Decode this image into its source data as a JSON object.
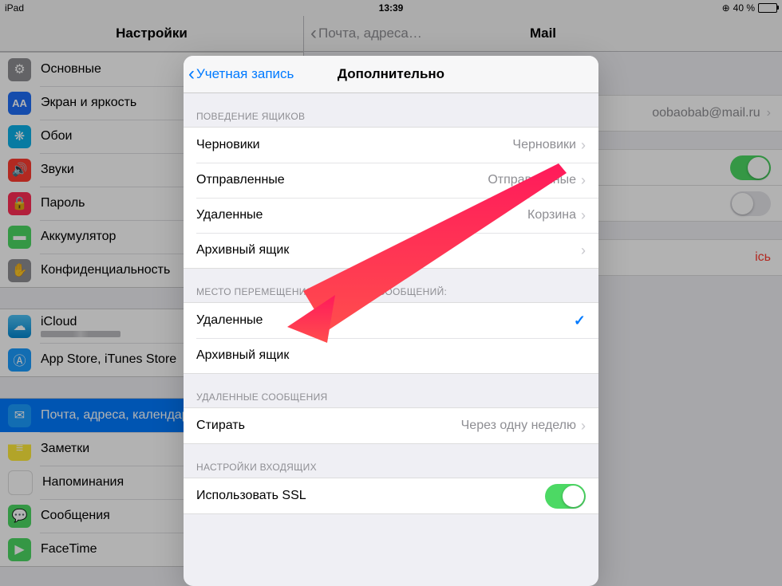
{
  "status": {
    "device": "iPad",
    "time": "13:39",
    "battery_pct": "40 %",
    "battery_fill": 40
  },
  "sidebar": {
    "title": "Настройки",
    "groups": [
      [
        {
          "icon": "gear-icon",
          "bg": "bg-gray",
          "label": "Основные"
        },
        {
          "icon": "brightness-icon",
          "bg": "bg-blue",
          "label": "Экран и яркость"
        },
        {
          "icon": "wallpaper-icon",
          "bg": "bg-cyan",
          "label": "Обои"
        },
        {
          "icon": "sound-icon",
          "bg": "bg-red",
          "label": "Звуки"
        },
        {
          "icon": "lock-icon",
          "bg": "bg-redlock",
          "label": "Пароль"
        },
        {
          "icon": "battery-icon",
          "bg": "bg-green",
          "label": "Аккумулятор"
        },
        {
          "icon": "privacy-icon",
          "bg": "bg-graykey",
          "label": "Конфиденциальность"
        }
      ],
      [
        {
          "icon": "icloud-icon",
          "bg": "bg-cloud",
          "label": "iCloud",
          "sub": true
        },
        {
          "icon": "appstore-icon",
          "bg": "bg-appstore",
          "label": "App Store, iTunes Store"
        }
      ],
      [
        {
          "icon": "mail-icon",
          "bg": "bg-mail",
          "label": "Почта, адреса, календари",
          "active": true
        },
        {
          "icon": "notes-icon",
          "bg": "bg-notes",
          "label": "Заметки"
        },
        {
          "icon": "reminders-icon",
          "bg": "bg-remind",
          "label": "Напоминания"
        },
        {
          "icon": "messages-icon",
          "bg": "bg-msg",
          "label": "Сообщения"
        },
        {
          "icon": "facetime-icon",
          "bg": "bg-ft",
          "label": "FaceTime"
        }
      ]
    ]
  },
  "detail": {
    "back_label": "Почта, адреса…",
    "title": "Mail",
    "account_email": "oobaobab@mail.ru",
    "delete_label_partial": "ісь"
  },
  "modal": {
    "back_label": "Учетная запись",
    "title": "Дополнительно",
    "section1": "Поведение ящиков",
    "mailbox_rows": [
      {
        "label": "Черновики",
        "value": "Черновики"
      },
      {
        "label": "Отправленные",
        "value": "Отправленные"
      },
      {
        "label": "Удаленные",
        "value": "Корзина"
      },
      {
        "label": "Архивный ящик",
        "value": ""
      }
    ],
    "section2": "Место перемещения ненужных сообщений:",
    "discard_rows": [
      {
        "label": "Удаленные",
        "checked": true
      },
      {
        "label": "Архивный ящик",
        "checked": false
      }
    ],
    "section3": "Удаленные сообщения",
    "remove_row": {
      "label": "Стирать",
      "value": "Через одну неделю"
    },
    "section4": "Настройки входящих",
    "ssl_row": {
      "label": "Использовать SSL",
      "on": true
    }
  }
}
